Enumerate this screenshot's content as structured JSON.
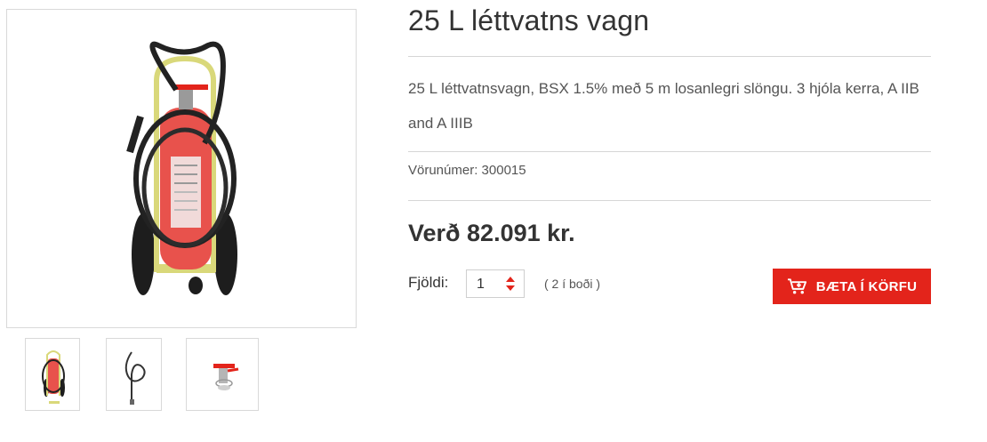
{
  "product": {
    "title": "25 L léttvatns vagn",
    "description": "25 L léttvatnsvagn, BSX 1.5% með 5 m losanlegri slöngu. 3 hjóla kerra, A IIB and A IIIB",
    "sku_label": "Vörunúmer:",
    "sku_value": "300015",
    "price": "Verð 82.091 kr."
  },
  "purchase": {
    "quantity_label": "Fjöldi:",
    "quantity_value": "1",
    "stock": "( 2 í boði )",
    "add_to_cart_label": "BÆTA Í KÖRFU"
  },
  "icons": {
    "cart": "shopping-cart-plus-icon",
    "stepper": "up-down-caret-icon"
  },
  "colors": {
    "accent": "#e3241b",
    "text": "#333333",
    "muted": "#555555",
    "divider": "#d6d6d6"
  }
}
